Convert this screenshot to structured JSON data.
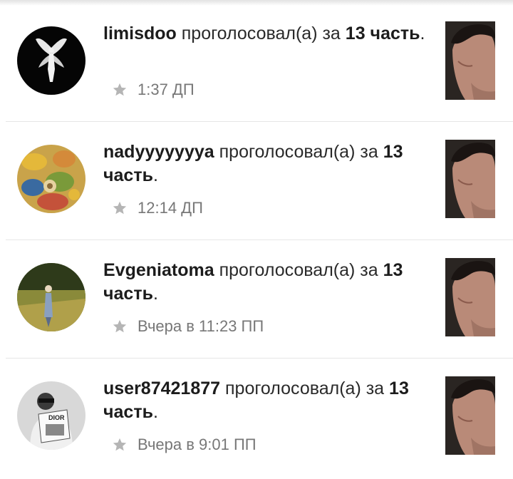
{
  "feed": {
    "items": [
      {
        "username": "limisdoo",
        "action": "проголосовал(а) за",
        "part": "13 часть",
        "period": ".",
        "time": "1:37 ДП",
        "avatar_icon": "angel-silhouette-avatar",
        "star_icon": "star-icon"
      },
      {
        "username": "nadyyyyyyya",
        "action": "проголосовал(а) за",
        "part": "13 часть",
        "period": ".",
        "time": "12:14 ДП",
        "avatar_icon": "colorful-pattern-avatar",
        "star_icon": "star-icon"
      },
      {
        "username": "Evgeniatoma",
        "action": "проголосовал(а) за",
        "part": "13 часть",
        "period": ".",
        "time": "Вчера в 11:23 ПП",
        "avatar_icon": "person-in-field-avatar",
        "star_icon": "star-icon"
      },
      {
        "username": "user87421877",
        "action": "проголосовал(а) за",
        "part": "13 часть",
        "period": ".",
        "time": "Вчера в 9:01 ПП",
        "avatar_icon": "person-reading-magazine-avatar",
        "star_icon": "star-icon"
      }
    ]
  },
  "colors": {
    "meta_text": "#777777",
    "star": "#b5b5b5",
    "divider": "#e6e6e6"
  }
}
